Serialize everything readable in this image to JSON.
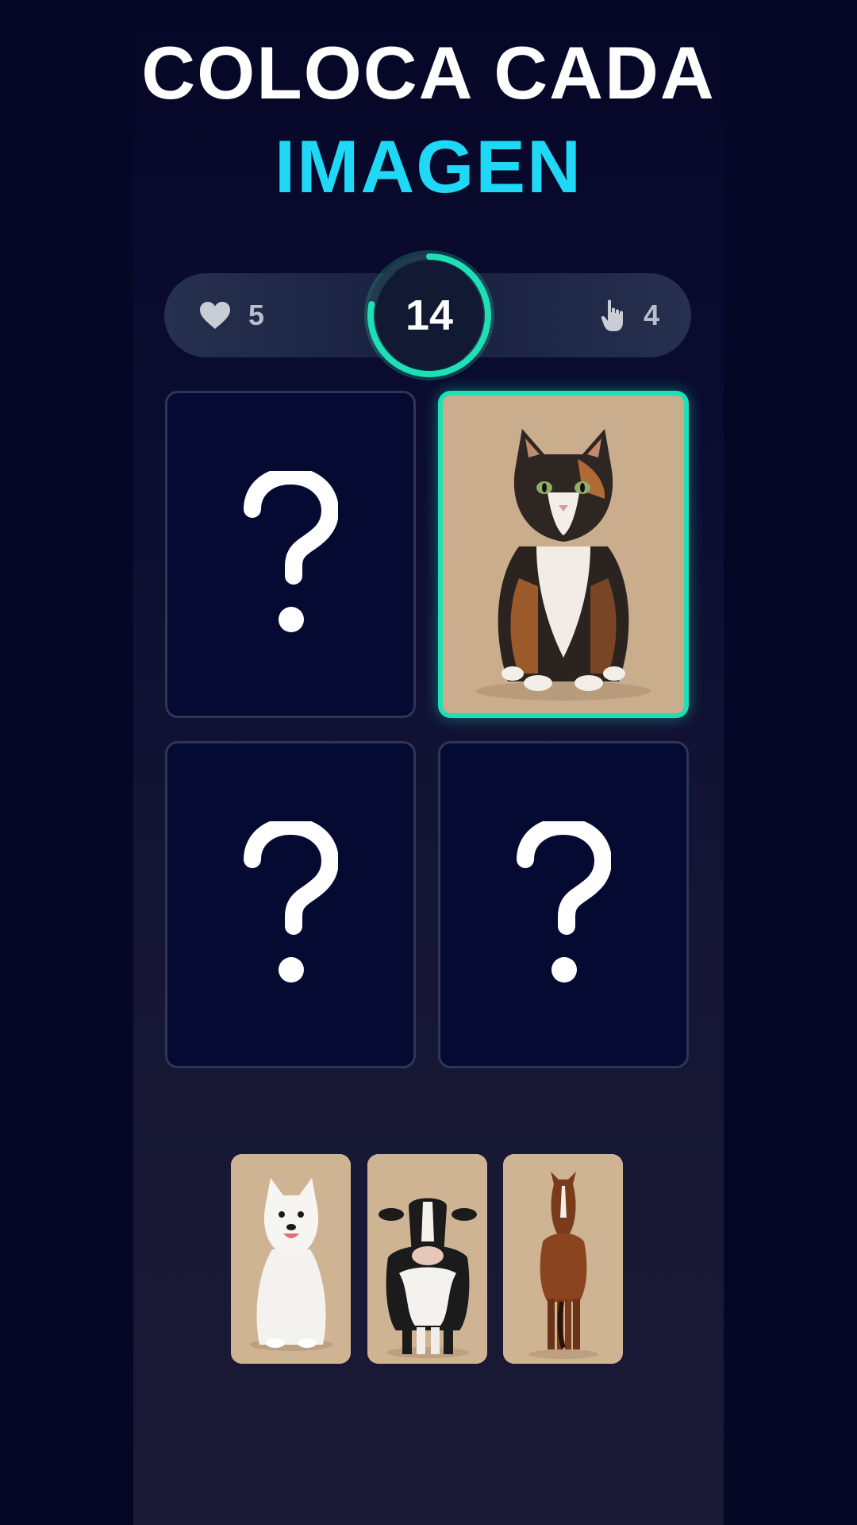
{
  "title": {
    "line1": "COLOCA CADA",
    "line2": "IMAGEN"
  },
  "hud": {
    "lives": "5",
    "lives_icon": "heart-icon",
    "timer": "14",
    "timer_progress": 0.78,
    "moves": "4",
    "moves_icon": "tap-hand-icon"
  },
  "board": {
    "cards": [
      {
        "state": "hidden",
        "symbol": "?"
      },
      {
        "state": "revealed",
        "image": "calico-cat"
      },
      {
        "state": "hidden",
        "symbol": "?"
      },
      {
        "state": "hidden",
        "symbol": "?"
      }
    ]
  },
  "tray": {
    "items": [
      {
        "image": "white-dog"
      },
      {
        "image": "cow"
      },
      {
        "image": "horse"
      }
    ]
  },
  "colors": {
    "accent_cyan": "#1fd8f5",
    "accent_green": "#1fe0b4",
    "background": "#060726"
  }
}
